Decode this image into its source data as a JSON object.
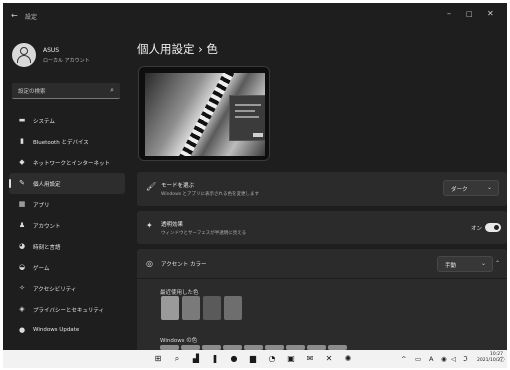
{
  "window": {
    "title": "設定",
    "controls": {
      "minimize": "–",
      "maximize": "□",
      "close": "✕"
    }
  },
  "profile": {
    "name": "ASUS",
    "account_type": "ローカル アカウント"
  },
  "search": {
    "placeholder": "設定の検索"
  },
  "sidebar": {
    "items": [
      {
        "label": "システム",
        "icon": "monitor-icon",
        "glyph": "▬"
      },
      {
        "label": "Bluetooth とデバイス",
        "icon": "bluetooth-icon",
        "glyph": "▮"
      },
      {
        "label": "ネットワークとインターネット",
        "icon": "wifi-icon",
        "glyph": "◆"
      },
      {
        "label": "個人用設定",
        "icon": "brush-icon",
        "glyph": "✎",
        "active": true
      },
      {
        "label": "アプリ",
        "icon": "apps-icon",
        "glyph": "▦"
      },
      {
        "label": "アカウント",
        "icon": "person-icon",
        "glyph": "♟"
      },
      {
        "label": "時刻と言語",
        "icon": "clock-icon",
        "glyph": "◕"
      },
      {
        "label": "ゲーム",
        "icon": "gamepad-icon",
        "glyph": "◒"
      },
      {
        "label": "アクセシビリティ",
        "icon": "accessibility-icon",
        "glyph": "✧"
      },
      {
        "label": "プライバシーとセキュリティ",
        "icon": "shield-icon",
        "glyph": "◈"
      },
      {
        "label": "Windows Update",
        "icon": "update-icon",
        "glyph": "●"
      }
    ]
  },
  "header": {
    "breadcrumb_parent": "個人用設定",
    "separator": "›",
    "current": "色"
  },
  "settings": {
    "mode": {
      "icon": "brush-icon",
      "glyph": "🖌",
      "title": "モードを選ぶ",
      "description": "Windows とアプリに表示される色を変更します",
      "value": "ダーク"
    },
    "transparency": {
      "icon": "transparency-icon",
      "glyph": "✦",
      "title": "透明効果",
      "description": "ウィンドウとサーフェスが半透明に見える",
      "state_label": "オン",
      "on": true
    },
    "accent": {
      "icon": "palette-icon",
      "glyph": "◎",
      "title": "アクセント カラー",
      "value": "手動",
      "recent_label": "最近使用した色",
      "recent_colors": [
        "#9a9a9a",
        "#7a7a7a",
        "#5a5a5a",
        "#6e6e6e"
      ],
      "windows_label": "Windows の色",
      "windows_colors": [
        "#8c8c8c",
        "#8c8c8c",
        "#8c8c8c",
        "#8c8c8c",
        "#8c8c8c",
        "#8c8c8c",
        "#8c8c8c",
        "#8c8c8c",
        "#8c8c8c"
      ]
    }
  },
  "taskbar": {
    "apps": [
      {
        "name": "start-icon",
        "glyph": "⊞"
      },
      {
        "name": "search-icon",
        "glyph": "⌕"
      },
      {
        "name": "widgets-icon",
        "glyph": "▟"
      },
      {
        "name": "task-view-icon",
        "glyph": "❚"
      },
      {
        "name": "chat-icon",
        "glyph": "●"
      },
      {
        "name": "file-explorer-icon",
        "glyph": "▆"
      },
      {
        "name": "edge-icon",
        "glyph": "◔"
      },
      {
        "name": "store-icon",
        "glyph": "▣"
      },
      {
        "name": "mail-icon",
        "glyph": "✉"
      },
      {
        "name": "xbox-icon",
        "glyph": "✕"
      },
      {
        "name": "settings-icon",
        "glyph": "✺"
      }
    ],
    "tray": {
      "chevron": "^",
      "input": "A",
      "time": "10:27",
      "date": "2021/10/27"
    }
  }
}
